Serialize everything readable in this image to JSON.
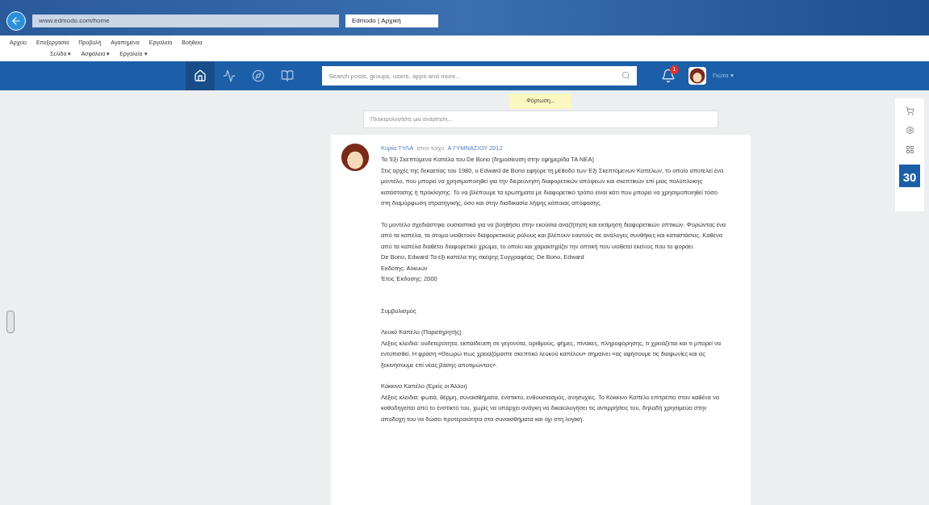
{
  "browser": {
    "address": "www.edmodo.com/home",
    "tab": {
      "title": "Edmodo | Αρχική",
      "selected": true
    },
    "menu": [
      "Αρχείο",
      "Επεξεργασία",
      "Προβολή",
      "Αγαπημένα",
      "Εργαλεία",
      "Βοήθεια"
    ],
    "commands": [
      "Σελίδα ▾",
      "Ασφάλεια ▾",
      "Εργαλεία ▾"
    ]
  },
  "header": {
    "nav": [
      {
        "kind": "home",
        "selected": true
      },
      {
        "kind": "activity",
        "selected": false
      },
      {
        "kind": "discover",
        "selected": false
      },
      {
        "kind": "library",
        "selected": false
      }
    ],
    "search": {
      "placeholder": "Search posts, groups, users, apps and more..."
    },
    "notifications": "1",
    "user": "Γιώτα ▾"
  },
  "loading": "Φόρτωση...",
  "composer": {
    "placeholder": "Πληκτρολογήστε μια ανάρτηση..."
  },
  "post": {
    "author": "Κυρία ΤΥΛΑ",
    "relation": "στον τοίχο",
    "group": "Α ΓΥΜΝΑΣΙΟΥ 2012",
    "paragraphs": [
      "Τα Έξι Σκεπτόμενα Καπέλα του De Bono (δημοσίευση στην εφημερίδα ΤΑ ΝΕΑ)\nΣτις αρχές της δεκαετίας του 1980, ο Edward de Bono εφηύρε τη μέθοδο των Έξι Σκεπτόμενων Καπέλων, το οποίο αποτελεί ένα μοντέλο, που μπορεί να χρησιμοποιηθεί για την διερεύνηση διαφορετικών απόψεων και σκεπτικών επί μιας πολύπλοκης κατάστασης ή πρόκλησης. Το να βλέπουμε τα ερωτήματα με διαφορετικό τρόπο είναι κάτι που μπορεί να χρησιμοποιηθεί τόσο στη διαμόρφωση στρατηγικής, όσο και στην διαδικασία λήψης κάποιας απόφασης.",
      "Το μοντέλο σχεδιάστηκε ουσιαστικά για να βοηθήσει στην εκούσια αναζήτηση και εκτίμηση διαφορετικών οπτικών. Φορώντας ένα από τα καπέλα, τα άτομα υιοθετούν διαφορετικούς ρόλους και βλέπουν εαυτούς σε ανάλογες συνθήκες και καταστάσεις. Καθένα από τα καπέλα διαθέτει διαφορετικό χρώμα, το οποίο και χαρακτηρίζει την οπτική που υιοθετεί εκείνος που το φοράει.\nDe Bono, Edward Τα έξι καπέλα της σκέψης Συγγραφέας: De Bono, Edward\nΕκδότης: Αλκυών\nΈτος Έκδοσης: 2000",
      "Συμβολισμός",
      "Λευκό Καπέλο (Παρατηρητής)\nΛέξεις κλειδιά: ουδετερότητα, εκπαίδευση σε γεγονότα, αριθμούς, φήμες, πίνακες, πληροφόρησης, τι χρειάζεται και τι μπορεί να εντοπισθεί. Η φράση «Θεωρώ πως χρειαζόμαστε σκεπτικό λευκού καπέλου» σημαίνει «ας αφήσουμε τις διαφωνίες και ας ξεκινήσουμε επί νέας βάσης αποτιμώντας».",
      "Κόκκινο Καπέλο (Εμείς οι Άλλοι)\nΛέξεις κλειδιά: φωτιά, θέρμη, συναισθήματα, ένστικτο, ενθουσιασμός, ανησυχίες. Το Κόκκινο Καπέλο επιτρέπει στον καθένα να καθοδηγείται από το ένστικτό του, χωρίς να υπάρχει ανάγκη να δικαιολογήσει τις αντιρρήσεις του, δηλαδή χρησιμεύει στην αποδοχή του να δώσει προτεραιότητα στα συναισθήματα και όχι στη λογική."
    ]
  },
  "tools": [
    {
      "kind": "cart"
    },
    {
      "kind": "gear"
    },
    {
      "kind": "grid"
    },
    {
      "kind": "calendar",
      "label": "30"
    }
  ]
}
